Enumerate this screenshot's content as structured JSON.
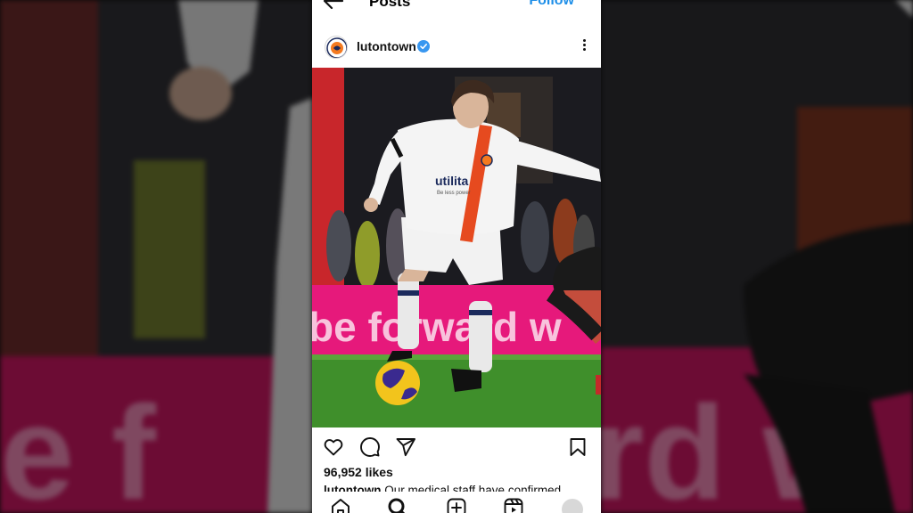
{
  "nav": {
    "title": "Posts",
    "follow_label": "Follow",
    "back_icon": "arrow-left-icon"
  },
  "post": {
    "username": "lutontown",
    "verified": true,
    "likes": "96,952 likes",
    "caption_user": "lutontown",
    "caption_text": "Our medical staff have confirmed"
  },
  "photo": {
    "board_text": "be forward w",
    "shirt_sponsor": "utilita",
    "shirt_subtext": "Be less power"
  },
  "colors": {
    "accent": "#1f8fe8",
    "verified": "#3897f0",
    "magenta_board": "#e6197b",
    "pitch": "#3f8f2b",
    "stripe": "#e64a1f"
  },
  "bottom_nav": {
    "items": [
      "home-icon",
      "search-icon",
      "create-icon",
      "reels-icon",
      "profile-avatar"
    ]
  }
}
